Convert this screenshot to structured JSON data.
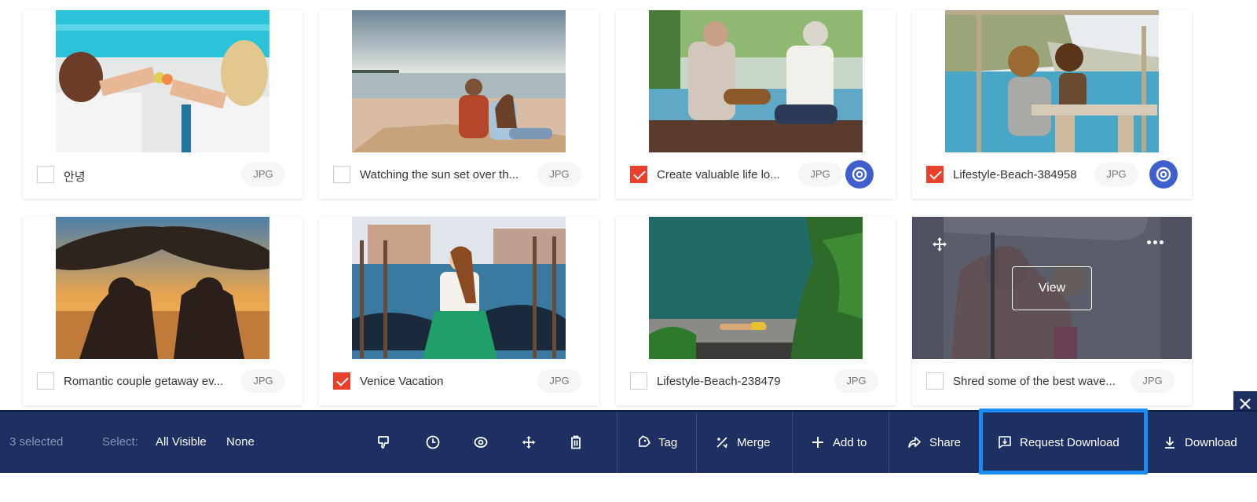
{
  "assets": [
    {
      "title": "안녕",
      "type": "JPG",
      "checked": false,
      "show_eye": false,
      "image": "pool-loungers"
    },
    {
      "title": "Watching the sun set over th...",
      "type": "JPG",
      "checked": false,
      "show_eye": false,
      "image": "beach-sunset-couple"
    },
    {
      "title": "Create valuable life lo...",
      "type": "JPG",
      "checked": true,
      "show_eye": true,
      "image": "seniors-guitar-pool"
    },
    {
      "title": "Lifestyle-Beach-384958",
      "type": "JPG",
      "checked": true,
      "show_eye": true,
      "image": "beach-hut-table"
    },
    {
      "title": "Romantic couple getaway ev...",
      "type": "JPG",
      "checked": false,
      "show_eye": false,
      "image": "surfers-silhouette"
    },
    {
      "title": "Venice Vacation",
      "type": "JPG",
      "checked": true,
      "show_eye": false,
      "image": "venice-gondolas"
    },
    {
      "title": "Lifestyle-Beach-238479",
      "type": "JPG",
      "checked": false,
      "show_eye": false,
      "image": "pool-sunbather"
    },
    {
      "title": "Shred some of the best wave...",
      "type": "JPG",
      "checked": false,
      "show_eye": false,
      "image": "surfers-board-overhead",
      "hover_view_label": "View"
    }
  ],
  "toolbar": {
    "selected_count": "3 selected",
    "select_label": "Select:",
    "select_all_visible": "All Visible",
    "select_none": "None",
    "icons": [
      "thumbs-down-icon",
      "clock-icon",
      "eye-icon",
      "move-icon",
      "trash-icon"
    ],
    "actions": {
      "tag": "Tag",
      "merge": "Merge",
      "add_to": "Add to",
      "share": "Share",
      "request_download": "Request Download",
      "download": "Download"
    }
  },
  "colors": {
    "toolbar_bg": "#1d3061",
    "checkbox_checked": "#e8402a",
    "eye_button": "#3f5fcf",
    "highlight": "#1a8cf0"
  }
}
